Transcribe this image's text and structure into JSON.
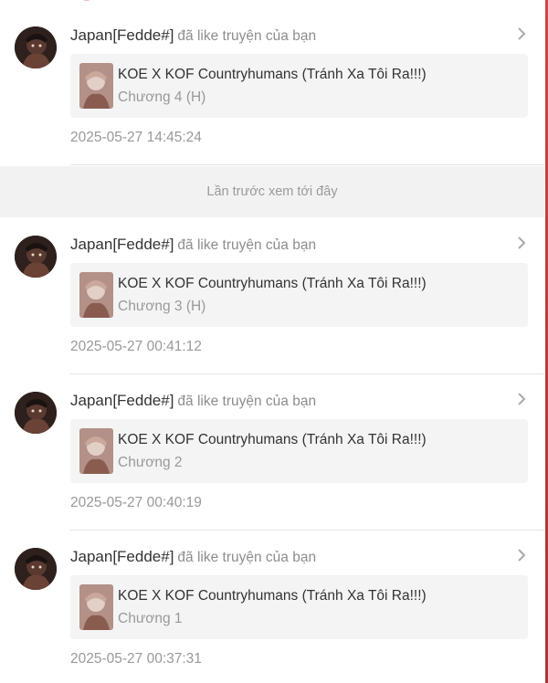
{
  "notifications": [
    {
      "user": "Japan[Fedde#]",
      "action": "đã like truyện của bạn",
      "story": "KOE X KOF Countryhumans (Tránh Xa Tôi Ra!!!)",
      "chapter": "Chương 4 (H)",
      "time": "2025-05-27 14:45:24"
    },
    {
      "user": "Japan[Fedde#]",
      "action": "đã like truyện của bạn",
      "story": "KOE X KOF Countryhumans (Tránh Xa Tôi Ra!!!)",
      "chapter": "Chương 3 (H)",
      "time": "2025-05-27 00:41:12"
    },
    {
      "user": "Japan[Fedde#]",
      "action": "đã like truyện của bạn",
      "story": "KOE X KOF Countryhumans (Tránh Xa Tôi Ra!!!)",
      "chapter": "Chương 2",
      "time": "2025-05-27 00:40:19"
    },
    {
      "user": "Japan[Fedde#]",
      "action": "đã like truyện của bạn",
      "story": "KOE X KOF Countryhumans (Tránh Xa Tôi Ra!!!)",
      "chapter": "Chương 1",
      "time": "2025-05-27 00:37:31"
    }
  ],
  "separator": {
    "label": "Lần trước xem tới đây"
  },
  "icons": {
    "chevron": "chevron-right-icon",
    "avatar": "user-avatar",
    "thumbnail": "story-cover"
  },
  "colors": {
    "accent": "#e26a7a",
    "muted_text": "#999999",
    "card_bg": "#f4f4f4",
    "separator_bg": "#f2f2f2",
    "edge": "#c44444"
  }
}
